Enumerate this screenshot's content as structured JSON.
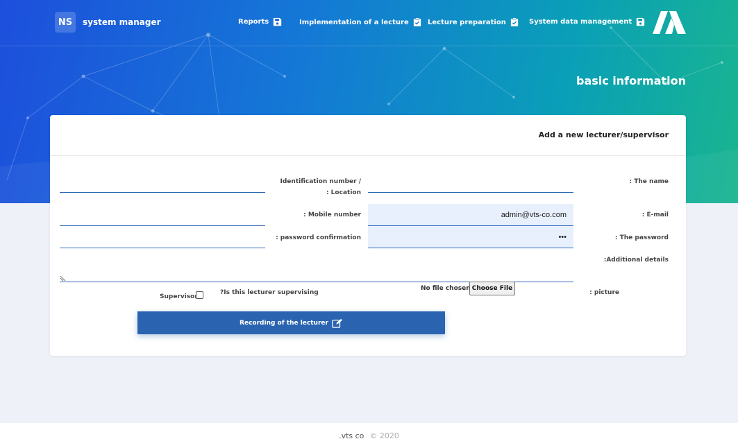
{
  "brand": {
    "badge": "NS",
    "name": "system manager",
    "logo_icon": "brand-logo-icon"
  },
  "nav": {
    "items": [
      {
        "label": "Reports",
        "icon": "save-icon"
      },
      {
        "label": "Implementation of a lecture",
        "icon": "clipboard-check-icon"
      },
      {
        "label": "Lecture preparation",
        "icon": "clipboard-check-icon"
      },
      {
        "label": "System data management",
        "icon": "save-icon"
      }
    ]
  },
  "hero": {
    "title": "basic information"
  },
  "form": {
    "title": "Add a new lecturer/supervisor",
    "labels": {
      "name": ": The name",
      "id_location_line1": "Identification number /",
      "id_location_line2": ": Location",
      "email": ": E-mail",
      "mobile": ": Mobile number",
      "password": ": The password",
      "password_confirm": ": password confirmation",
      "details": ":Additional details",
      "picture": ": picture",
      "supervising_question": "?Is this lecturer supervising",
      "supervisor": "Supervisor"
    },
    "values": {
      "name": "",
      "id_location": "",
      "email": "admin@vts-co.com",
      "mobile": "",
      "password": "•••",
      "password_confirm": "",
      "details": ""
    },
    "file": {
      "status": "No file chosen",
      "button": "Choose File"
    },
    "supervisor_checked": false,
    "submit_label": "Recording of the lecturer",
    "submit_icon": "edit-icon"
  },
  "footer": {
    "company": ".vts co",
    "copyright": "© 2020"
  },
  "colors": {
    "accent": "#2a64b0",
    "hero_start": "#1d4fdc",
    "hero_end": "#19b58f",
    "field_filled": "#e8f0fe"
  }
}
